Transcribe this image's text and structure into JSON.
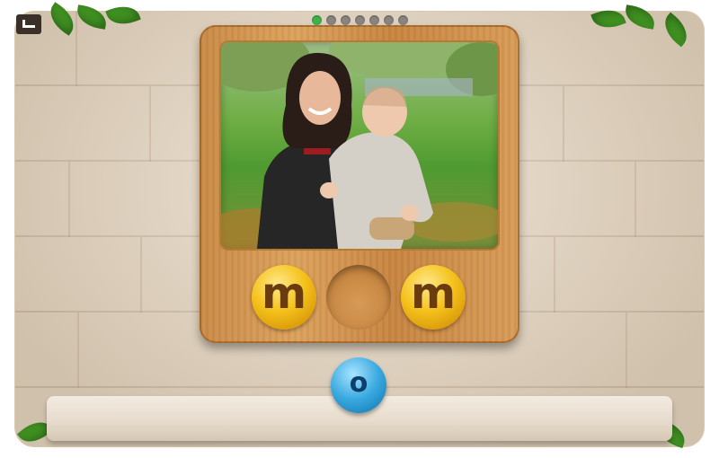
{
  "game": {
    "progress": {
      "total": 7,
      "current": 1
    },
    "board_letters": [
      {
        "letter": "m",
        "filled": true
      },
      {
        "letter": "",
        "filled": false
      },
      {
        "letter": "m",
        "filled": true
      }
    ],
    "available_letter": "o",
    "colors": {
      "wood": "#d79b57",
      "gold": "#f5c21b",
      "blue": "#38a9e0",
      "active_dot": "#3fb34a",
      "inactive_dot": "#8b8581"
    },
    "icons": {
      "back": "back-arrow-icon"
    }
  }
}
